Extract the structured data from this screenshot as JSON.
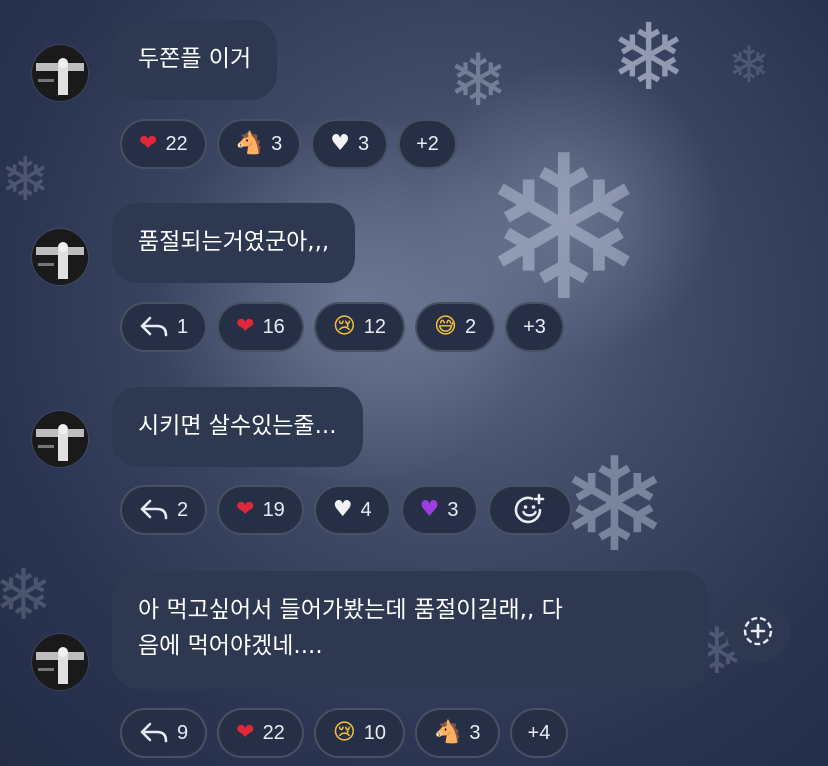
{
  "messages": [
    {
      "text": "두쫀플 이거",
      "reactions": [
        {
          "type": "emoji",
          "icon": "red-heart",
          "emoji": "❤",
          "color": "#e0283a",
          "count": "22"
        },
        {
          "type": "emoji",
          "icon": "horse-face",
          "emoji": "🐴",
          "color": "#b7bcc6",
          "count": "3"
        },
        {
          "type": "emoji",
          "icon": "white-heart",
          "emoji": "♥",
          "color": "#f2f2f2",
          "count": "3"
        },
        {
          "type": "more",
          "label": "+2"
        }
      ]
    },
    {
      "text": "품절되는거였군아,,,",
      "reactions": [
        {
          "type": "reply",
          "icon": "reply-arrow",
          "count": "1"
        },
        {
          "type": "emoji",
          "icon": "red-heart",
          "emoji": "❤",
          "color": "#e0283a",
          "count": "16"
        },
        {
          "type": "emoji",
          "icon": "crying-face",
          "emoji": "😢",
          "color": "#f5c33b",
          "count": "12"
        },
        {
          "type": "emoji",
          "icon": "grinning-sweat-face",
          "emoji": "😅",
          "color": "#f5c33b",
          "count": "2"
        },
        {
          "type": "more",
          "label": "+3"
        }
      ]
    },
    {
      "text": "시키면 살수있는줄...",
      "reactions": [
        {
          "type": "reply",
          "icon": "reply-arrow",
          "count": "2"
        },
        {
          "type": "emoji",
          "icon": "red-heart",
          "emoji": "❤",
          "color": "#e0283a",
          "count": "19"
        },
        {
          "type": "emoji",
          "icon": "white-heart",
          "emoji": "♥",
          "color": "#f2f2f2",
          "count": "4"
        },
        {
          "type": "emoji",
          "icon": "purple-heart",
          "emoji": "♥",
          "color": "#9b3fe0",
          "count": "3"
        },
        {
          "type": "add",
          "icon": "add-emoji-icon"
        }
      ]
    },
    {
      "text": "아 먹고싶어서 들어가봤는데 품절이길래,, 다\n음에 먹어야겠네....",
      "reactions": [
        {
          "type": "reply",
          "icon": "reply-arrow",
          "count": "9"
        },
        {
          "type": "emoji",
          "icon": "red-heart",
          "emoji": "❤",
          "color": "#e0283a",
          "count": "22"
        },
        {
          "type": "emoji",
          "icon": "crying-face",
          "emoji": "😢",
          "color": "#f5c33b",
          "count": "10"
        },
        {
          "type": "emoji",
          "icon": "horse-face",
          "emoji": "🐴",
          "color": "#b7bcc6",
          "count": "3"
        },
        {
          "type": "more",
          "label": "+4"
        }
      ]
    }
  ],
  "side_action": {
    "icon": "add-reaction-icon"
  }
}
